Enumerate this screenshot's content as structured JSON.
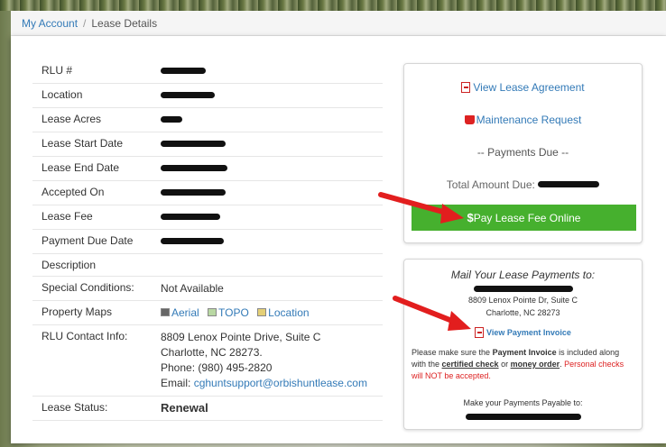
{
  "breadcrumb": {
    "home": "My Account",
    "current": "Lease Details"
  },
  "details": {
    "rlu_label": "RLU #",
    "location_label": "Location",
    "acres_label": "Lease Acres",
    "start_label": "Lease Start Date",
    "end_label": "Lease End Date",
    "accepted_label": "Accepted On",
    "fee_label": "Lease Fee",
    "due_date_label": "Payment Due Date",
    "description_label": "Description",
    "special_label": "Special Conditions:",
    "special_value": "Not Available",
    "maps_label": "Property Maps",
    "maps": {
      "aerial": "Aerial",
      "topo": "TOPO",
      "location": "Location"
    },
    "contact_label": "RLU Contact Info:",
    "contact": {
      "line1": "8809 Lenox Pointe Drive, Suite C",
      "line2": "Charlotte, NC 28273.",
      "phone": "Phone: (980) 495-2820",
      "email_prefix": "Email: ",
      "email": "cghuntsupport@orbishuntlease.com"
    },
    "status_label": "Lease Status:",
    "status_value": "Renewal"
  },
  "actions": {
    "view_agreement": "View Lease Agreement",
    "maintenance": "Maintenance Request",
    "payments_due": "-- Payments Due --",
    "total_due_label": "Total Amount Due:",
    "pay_button_symbol": "$",
    "pay_button": "Pay Lease Fee Online"
  },
  "mail": {
    "title": "Mail Your Lease Payments to:",
    "address1": "8809 Lenox Pointe Dr, Suite C",
    "address2": "Charlotte, NC 28273",
    "invoice_link": "View Payment Invoice",
    "note_part1": "Please make sure the ",
    "note_bold": "Payment Invoice",
    "note_part2": " is included along with the ",
    "note_u1": "certified check",
    "note_or": " or ",
    "note_u2": "money order",
    "note_dot": ".",
    "note_red": "Personal checks will NOT be accepted.",
    "payable": "Make your Payments Payable to:"
  },
  "colors": {
    "link": "#337ab7",
    "pay_button": "#46b02e",
    "renewal": "#2e9a2e",
    "warning": "#dd2222",
    "arrow": "#e21e1e"
  }
}
